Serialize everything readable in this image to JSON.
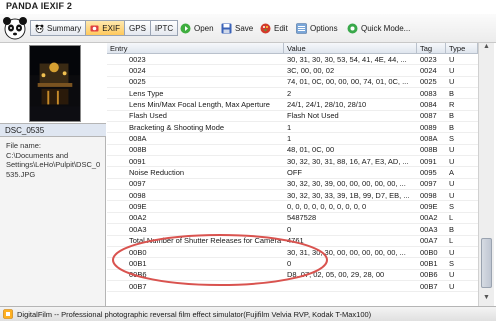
{
  "window": {
    "title": "PANDA IEXIF 2"
  },
  "tabs": [
    {
      "label": "Summary",
      "icon": "panda-icon",
      "active": false
    },
    {
      "label": "EXIF",
      "icon": "exif-icon",
      "active": true
    },
    {
      "label": "GPS",
      "icon": "",
      "active": false
    },
    {
      "label": "IPTC",
      "icon": "",
      "active": false
    }
  ],
  "toolbar": {
    "open_label": "Open",
    "save_label": "Save",
    "edit_label": "Edit",
    "options_label": "Options",
    "quickmode_label": "Quick Mode..."
  },
  "file": {
    "name": "DSC_0535",
    "info": "File name:\nC:\\Documents and Settings\\LeHo\\Pulpit\\DSC_0535.JPG"
  },
  "table": {
    "headers": {
      "entry": "Entry",
      "value": "Value",
      "tag": "Tag",
      "type": "Type"
    },
    "rows": [
      {
        "entry": "0023",
        "value": "30, 31, 30, 30, 53, 54, 41, 4E, 44, ...",
        "tag": "0023",
        "type": "U"
      },
      {
        "entry": "0024",
        "value": "3C, 00, 00, 02",
        "tag": "0024",
        "type": "U"
      },
      {
        "entry": "0025",
        "value": "74, 01, 0C, 00, 00, 00, 74, 01, 0C, ...",
        "tag": "0025",
        "type": "U"
      },
      {
        "entry": "Lens Type",
        "value": "2",
        "tag": "0083",
        "type": "B"
      },
      {
        "entry": "Lens Min/Max Focal Length, Max Aperture",
        "value": "24/1, 24/1, 28/10, 28/10",
        "tag": "0084",
        "type": "R"
      },
      {
        "entry": "Flash Used",
        "value": "Flash Not Used",
        "tag": "0087",
        "type": "B"
      },
      {
        "entry": "Bracketing & Shooting Mode",
        "value": "1",
        "tag": "0089",
        "type": "B"
      },
      {
        "entry": "008A",
        "value": "1",
        "tag": "008A",
        "type": "S"
      },
      {
        "entry": "008B",
        "value": "48, 01, 0C, 00",
        "tag": "008B",
        "type": "U"
      },
      {
        "entry": "0091",
        "value": "30, 32, 30, 31, 88, 16, A7, E3, AD, ...",
        "tag": "0091",
        "type": "U"
      },
      {
        "entry": "Noise Reduction",
        "value": "OFF",
        "tag": "0095",
        "type": "A"
      },
      {
        "entry": "0097",
        "value": "30, 32, 30, 39, 00, 00, 00, 00, 00, ...",
        "tag": "0097",
        "type": "U"
      },
      {
        "entry": "0098",
        "value": "30, 32, 30, 33, 39, 1B, 99, D7, EB, ...",
        "tag": "0098",
        "type": "U"
      },
      {
        "entry": "009E",
        "value": "0, 0, 0, 0, 0, 0, 0, 0, 0, 0",
        "tag": "009E",
        "type": "S"
      },
      {
        "entry": "00A2",
        "value": "5487528",
        "tag": "00A2",
        "type": "L"
      },
      {
        "entry": "00A3",
        "value": "0",
        "tag": "00A3",
        "type": "B"
      },
      {
        "entry": "Total Number of Shutter Releases for Camera",
        "value": "4761",
        "tag": "00A7",
        "type": "L"
      },
      {
        "entry": "00B0",
        "value": "30, 31, 30, 30, 00, 00, 00, 00, 00, ...",
        "tag": "00B0",
        "type": "U"
      },
      {
        "entry": "00B1",
        "value": "0",
        "tag": "00B1",
        "type": "S"
      },
      {
        "entry": "00B6",
        "value": "D8, 07, 02, 05, 00, 29, 28, 00",
        "tag": "00B6",
        "type": "U"
      },
      {
        "entry": "00B7",
        "value": "",
        "tag": "00B7",
        "type": "U"
      }
    ]
  },
  "status": {
    "text": "DigitalFilm -- Professional photographic reversal film effect simulator(Fujifilm Velvia RVP, Kodak T-Max100)"
  },
  "colors": {
    "annotation": "#d9534f",
    "active_tab": "#ffc95c",
    "header_bg": "#dfe5ee"
  }
}
